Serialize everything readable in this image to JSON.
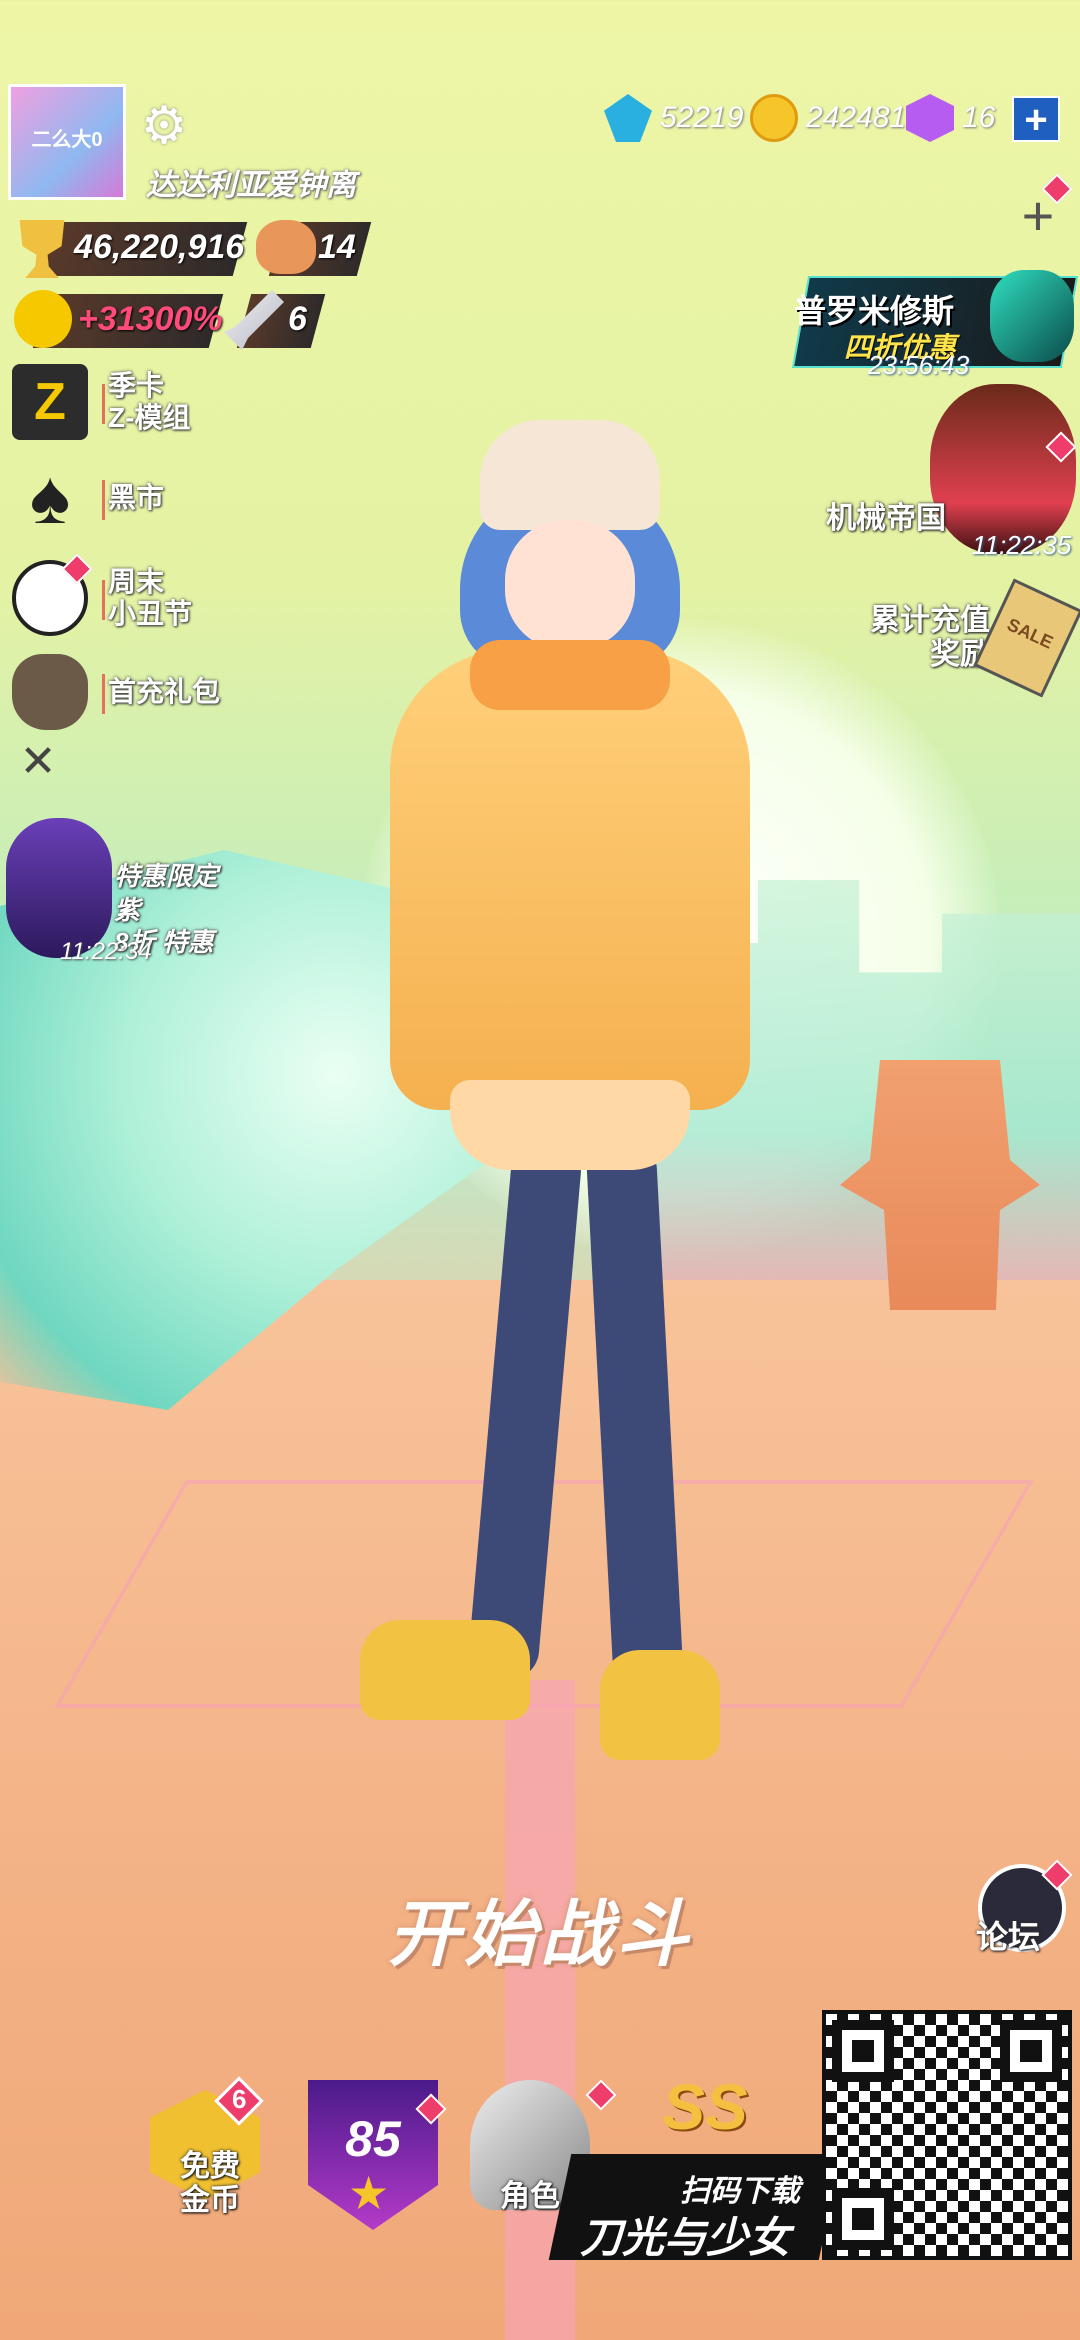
{
  "player": {
    "avatar_text": "二么大0",
    "username": "达达利亚爱钟离"
  },
  "currencies": [
    {
      "icon": "diamond-icon",
      "value": "52219"
    },
    {
      "icon": "coin-icon",
      "value": "242481"
    },
    {
      "icon": "cube-icon",
      "value": "16"
    }
  ],
  "stats": {
    "trophies": "46,220,916",
    "bears": "14",
    "bonus": "+31300%",
    "swords": "6"
  },
  "left_menu": [
    {
      "icon": "z-module-icon",
      "label_line1": "季卡",
      "label_line2": "Z-模组"
    },
    {
      "icon": "spade-icon",
      "label_line1": "黑市",
      "label_line2": ""
    },
    {
      "icon": "clown-icon",
      "label_line1": "周末",
      "label_line2": "小丑节"
    },
    {
      "icon": "gift-bag-icon",
      "label_line1": "首充礼包",
      "label_line2": ""
    }
  ],
  "promo": {
    "line1": "特惠限定",
    "line2": "紫",
    "line3": "8折 特惠",
    "timer": "11:22:34"
  },
  "right_events": {
    "prometheus": {
      "title": "普罗米修斯",
      "sub": "四折优惠",
      "timer": "23:56:43"
    },
    "mech": {
      "title": "机械帝国",
      "timer": "11:22:35"
    },
    "recharge": {
      "line1": "累计充值",
      "line2": "奖励",
      "tag": "SALE"
    }
  },
  "main": {
    "start_label": "开始战斗",
    "forum_label": "论坛"
  },
  "bottom_bar": {
    "free_gold_line1": "免费",
    "free_gold_line2": "金币",
    "free_gold_badge": "6",
    "level": "85",
    "role_label": "角色",
    "ss_label": "SS"
  },
  "download": {
    "small": "扫码下载",
    "big": "刀光与少女"
  },
  "colors": {
    "badge": "#ee3d6a",
    "accent_blue": "#1f5fc0",
    "gold": "#f5c52a"
  }
}
